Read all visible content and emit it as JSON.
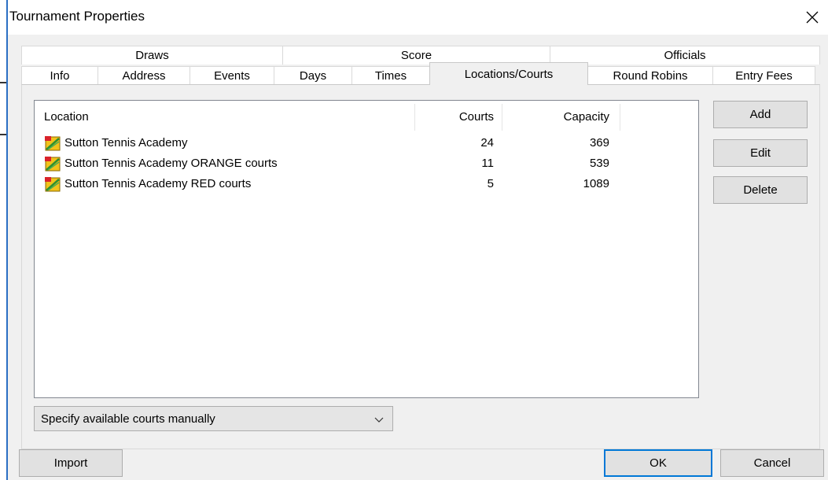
{
  "window": {
    "title": "Tournament Properties"
  },
  "tabs": {
    "upper": [
      "Draws",
      "Score",
      "Officials"
    ],
    "lower": [
      "Info",
      "Address",
      "Events",
      "Days",
      "Times",
      "Locations/Courts",
      "Round Robins",
      "Entry Fees"
    ],
    "active": "Locations/Courts"
  },
  "list": {
    "columns": {
      "location": "Location",
      "courts": "Courts",
      "capacity": "Capacity"
    },
    "rows": [
      {
        "location": "Sutton Tennis Academy",
        "courts": "24",
        "capacity": "369"
      },
      {
        "location": "Sutton Tennis Academy ORANGE courts",
        "courts": "11",
        "capacity": "539"
      },
      {
        "location": "Sutton Tennis Academy RED courts",
        "courts": "5",
        "capacity": "1089"
      }
    ],
    "row_icon": "location-icon"
  },
  "side_buttons": {
    "add": "Add",
    "edit": "Edit",
    "delete": "Delete"
  },
  "courts_mode": {
    "selected": "Specify available courts manually"
  },
  "footer": {
    "import": "Import",
    "ok": "OK",
    "cancel": "Cancel"
  },
  "icons": {
    "close": "close-icon",
    "dropdown": "chevron-down-icon"
  },
  "colors": {
    "accent": "#0078d7",
    "dialog_bg": "#f0f0f0"
  }
}
